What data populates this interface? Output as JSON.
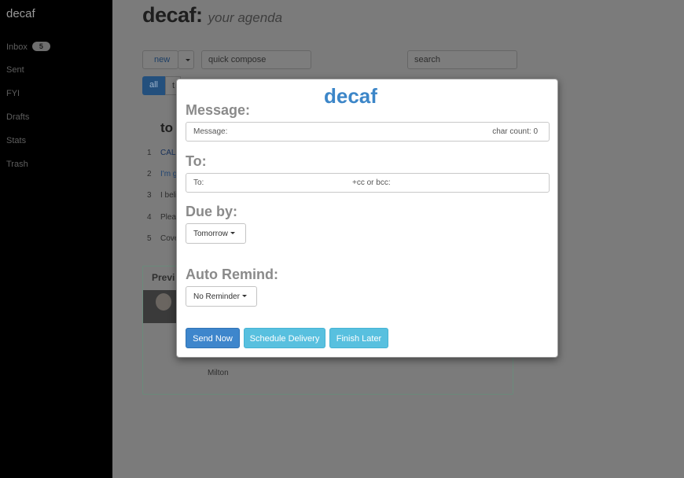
{
  "sidebar": {
    "brand": "decaf",
    "items": [
      {
        "label": "Inbox",
        "badge": "5"
      },
      {
        "label": "Sent"
      },
      {
        "label": "FYI"
      },
      {
        "label": "Drafts"
      },
      {
        "label": "Stats"
      },
      {
        "label": "Trash"
      }
    ]
  },
  "header": {
    "title": "decaf:",
    "subtitle": "your agenda"
  },
  "toolbar": {
    "new_label": "new",
    "quick_compose": "quick compose",
    "search": "search",
    "filter_all": "all",
    "filter_t": "t"
  },
  "background": {
    "section_heading": "to",
    "rows": [
      {
        "num": "1",
        "text": "CAL"
      },
      {
        "num": "2",
        "text": "I'm g"
      },
      {
        "num": "3",
        "text": "I beli"
      },
      {
        "num": "4",
        "text": "Plea"
      },
      {
        "num": "5",
        "text": "Cove"
      }
    ],
    "preview_label": "Previ",
    "preview_name": "Milton"
  },
  "modal": {
    "brand": "decaf",
    "message_label": "Message:",
    "message_placeholder": "Message:",
    "char_count": "char count: 0",
    "to_label": "To:",
    "to_placeholder": "To:",
    "cc_placeholder": "+cc or bcc:",
    "due_label": "Due by:",
    "due_value": "Tomorrow",
    "remind_label": "Auto Remind:",
    "remind_value": "No Reminder",
    "send_now": "Send Now",
    "schedule": "Schedule Delivery",
    "finish_later": "Finish Later"
  },
  "colors": {
    "accent": "#3c86c8",
    "primary_button": "#3e86cc",
    "info_button": "#58c0df"
  }
}
